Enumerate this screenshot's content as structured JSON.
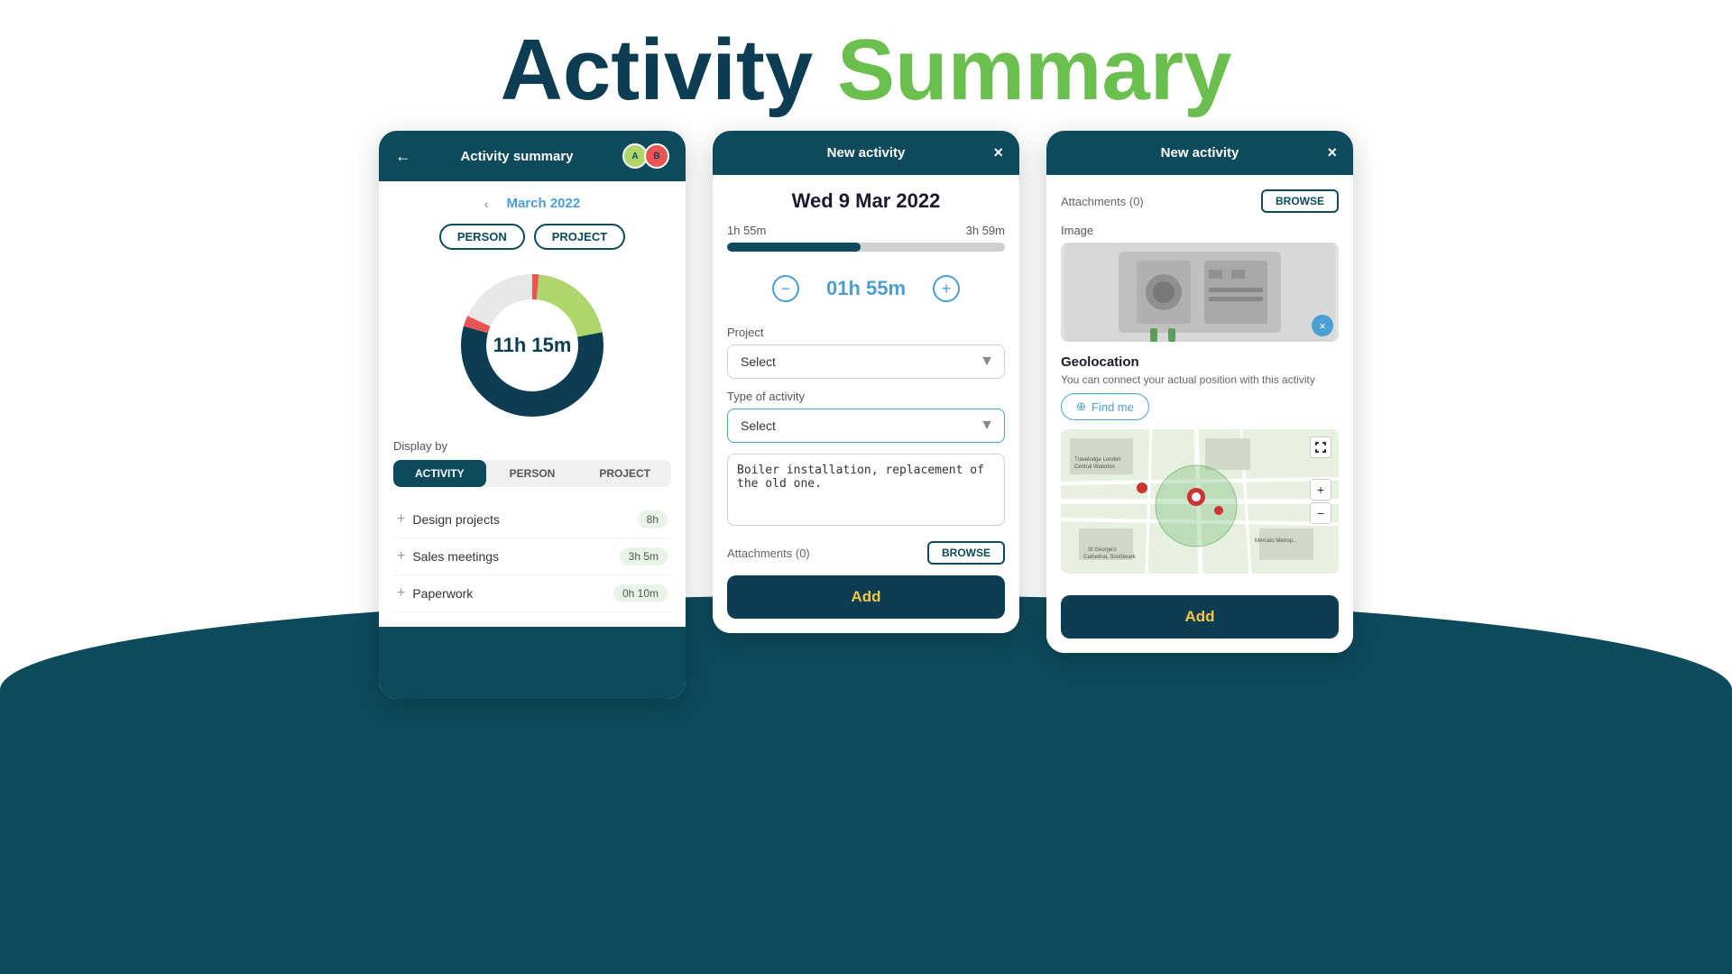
{
  "page": {
    "title_part1": "Activity",
    "title_part2": "Summary"
  },
  "card1": {
    "header_title": "Activity summary",
    "month": "March 2022",
    "filter_btn1": "PERSON",
    "filter_btn2": "PROJECT",
    "donut_label": "11h 15m",
    "display_by_label": "Display by",
    "tabs": [
      "ACTIVITY",
      "PERSON",
      "PROJECT"
    ],
    "active_tab": 0,
    "items": [
      {
        "name": "Design projects",
        "time": "8h"
      },
      {
        "name": "Sales meetings",
        "time": "3h 5m"
      },
      {
        "name": "Paperwork",
        "time": "0h 10m"
      }
    ]
  },
  "card2": {
    "header_title": "New activity",
    "close_icon": "×",
    "date": "Wed 9 Mar 2022",
    "time_start": "1h 55m",
    "time_end": "3h 59m",
    "progress_pct": 48,
    "time_value": "01h 55m",
    "project_label": "Project",
    "project_placeholder": "Select",
    "activity_label": "Type of activity",
    "activity_placeholder": "Select",
    "notes_value": "Boiler installation, replacement of the old one.",
    "attachments_label": "Attachments (0)",
    "browse_label": "BROWSE",
    "add_label": "Add"
  },
  "card3": {
    "header_title": "New activity",
    "close_icon": "×",
    "attachments_label": "Attachments (0)",
    "browse_label": "BROWSE",
    "image_label": "Image",
    "geolocation_title": "Geolocation",
    "geolocation_desc": "You can connect your actual position with this activity",
    "find_me_label": "Find me",
    "add_label": "Add"
  }
}
